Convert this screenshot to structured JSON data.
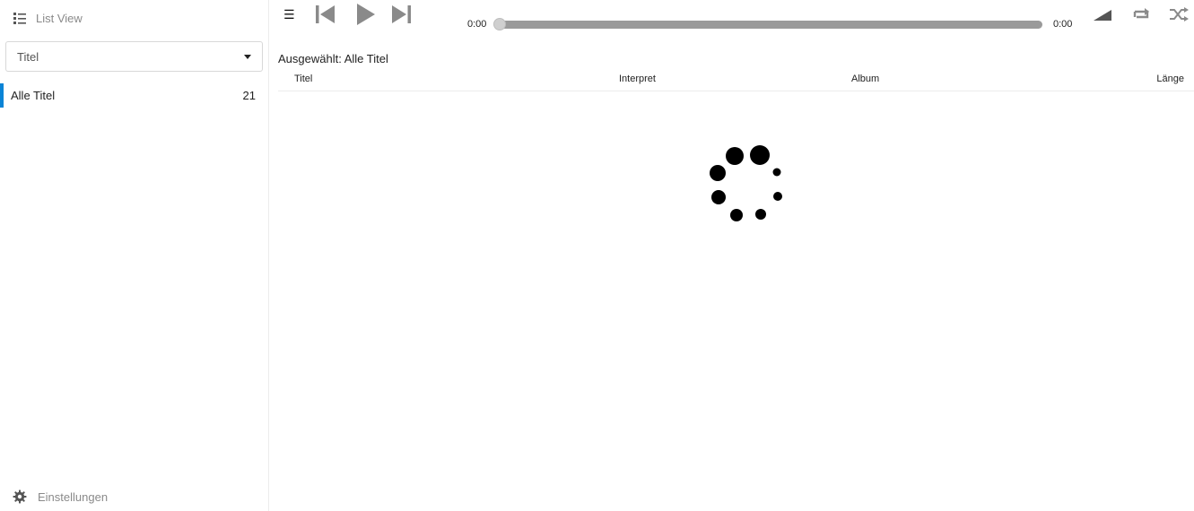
{
  "sidebar": {
    "list_view_label": "List View",
    "filter_select": {
      "selected": "Titel"
    },
    "items": [
      {
        "label": "Alle Titel",
        "count": "21",
        "active": true
      }
    ],
    "settings_label": "Einstellungen"
  },
  "player": {
    "current_time": "0:00",
    "total_time": "0:00",
    "progress": 0
  },
  "main": {
    "selected_label": "Ausgewählt: Alle Titel",
    "columns": [
      "Titel",
      "Interpret",
      "Album",
      "Länge"
    ]
  },
  "colors": {
    "accent": "#0a84d6",
    "progress_track": "#9a9a9a",
    "icon": "#8a8a8a"
  },
  "icons": {
    "list_view": "list-icon",
    "settings": "gear-icon",
    "menu": "hamburger-icon",
    "prev": "skip-previous-icon",
    "play": "play-icon",
    "next": "skip-next-icon",
    "volume": "volume-icon",
    "repeat": "repeat-icon",
    "shuffle": "shuffle-icon",
    "loading": "loading-spinner-icon"
  }
}
